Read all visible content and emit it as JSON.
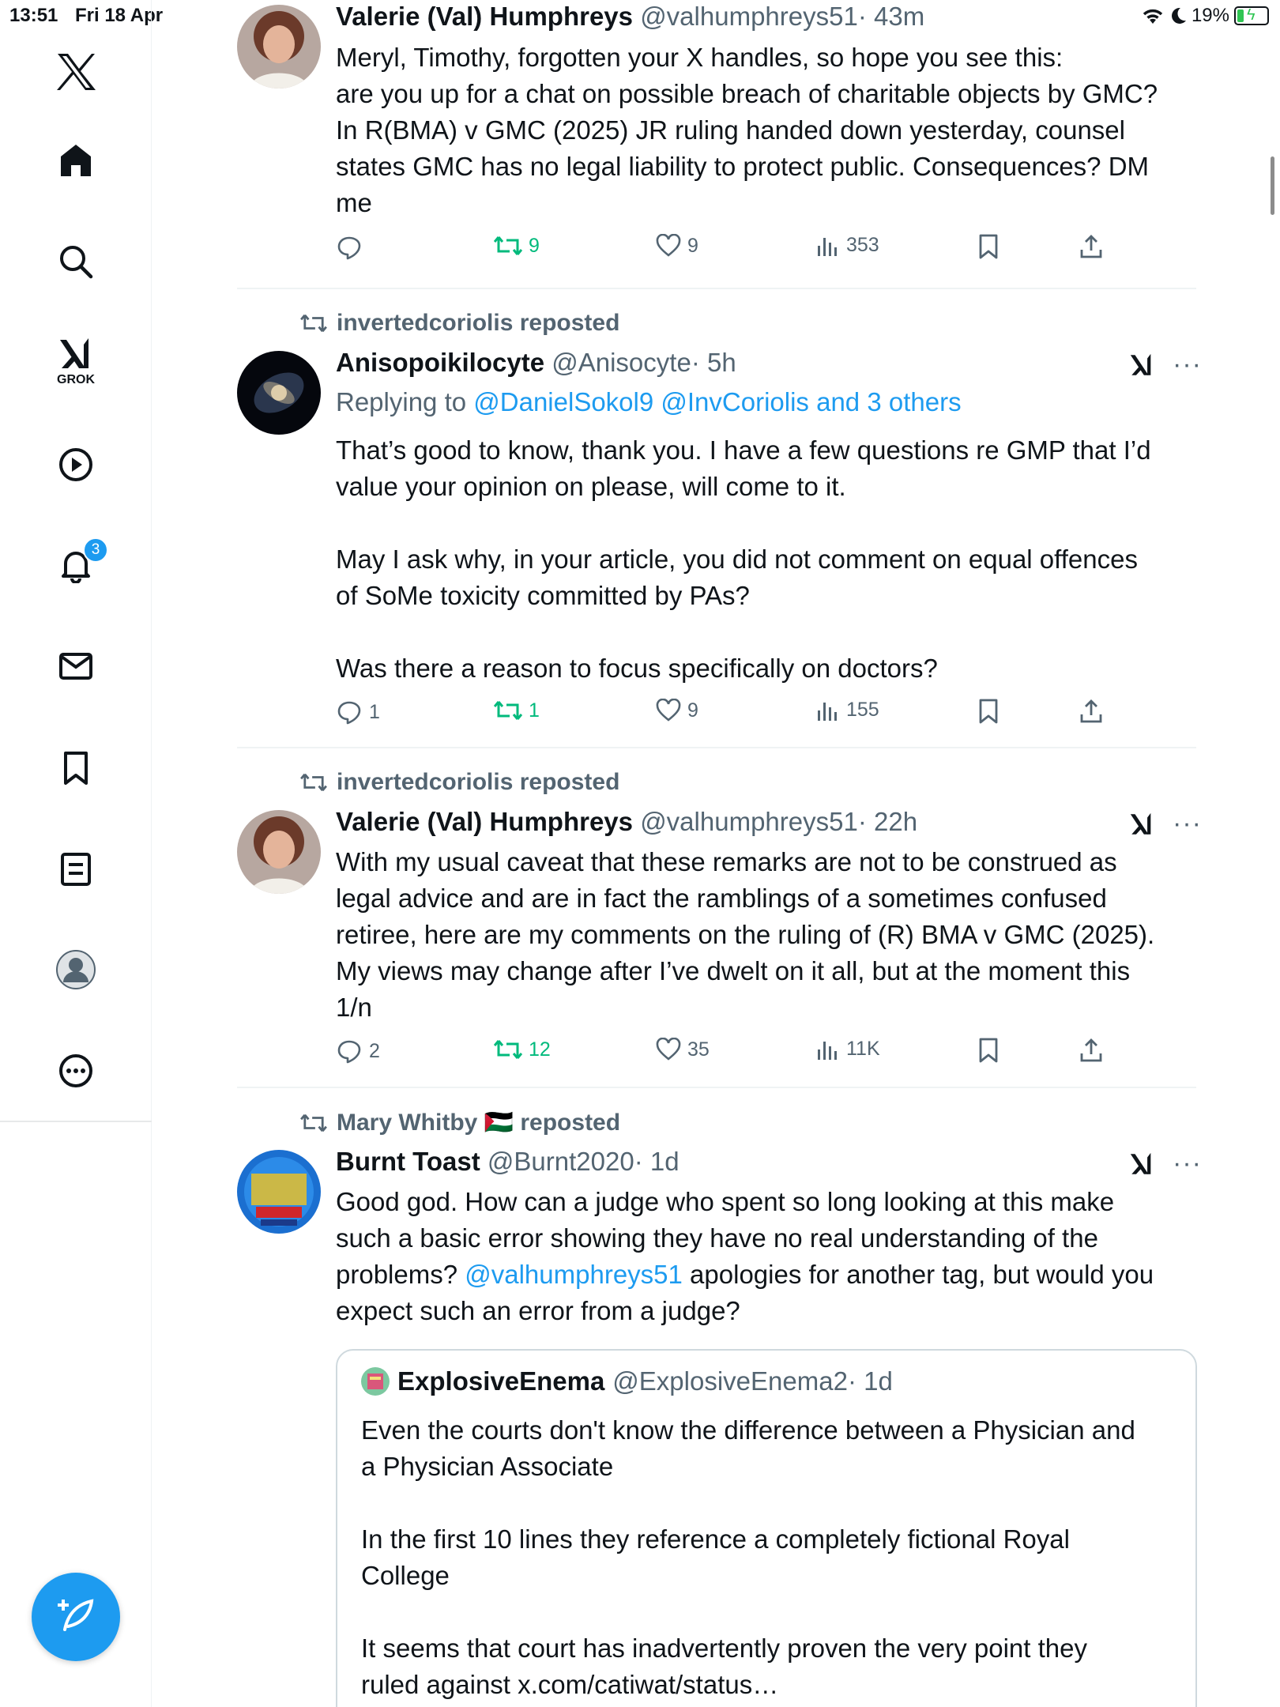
{
  "status_bar": {
    "time": "13:51",
    "date": "Fri 18 Apr",
    "battery": "19%"
  },
  "sidebar": {
    "items": [
      {
        "name": "x-logo-icon"
      },
      {
        "name": "home-icon"
      },
      {
        "name": "search-icon"
      },
      {
        "name": "grok-icon",
        "label": "GROK"
      },
      {
        "name": "play-icon"
      },
      {
        "name": "notifications-icon",
        "badge": "3"
      },
      {
        "name": "mail-icon"
      },
      {
        "name": "bookmark-icon"
      },
      {
        "name": "lists-icon"
      },
      {
        "name": "profile-icon"
      },
      {
        "name": "more-icon"
      }
    ]
  },
  "posts": [
    {
      "name": "Valerie (Val) Humphreys",
      "handle": "@valhumphreys51",
      "time": "· 43m",
      "text": "Meryl, Timothy, forgotten your X handles, so hope you see this:\nare you up for a chat on possible breach of charitable objects by GMC?\nIn R(BMA) v GMC (2025) JR ruling handed down yesterday, counsel\nstates GMC has no legal liability to protect public. Consequences? DM\nme",
      "replies": "",
      "reposts": "9",
      "likes": "9",
      "views": "353"
    },
    {
      "repost_by": "invertedcoriolis reposted",
      "name": "Anisopoikilocyte",
      "handle": "@Anisocyte",
      "time": "· 5h",
      "replying_prefix": "Replying to ",
      "replying_to": "@DanielSokol9 @InvCoriolis and 3 others",
      "text": "That’s good to know, thank you. I have a few questions re GMP that I’d\nvalue your opinion on please, will come to it.\n\nMay I ask why, in your article, you did not comment on equal offences\nof SoMe toxicity committed by PAs?\n\nWas there a reason to focus specifically on doctors?",
      "replies": "1",
      "reposts": "1",
      "likes": "9",
      "views": "155"
    },
    {
      "repost_by": "invertedcoriolis reposted",
      "name": "Valerie (Val) Humphreys",
      "handle": "@valhumphreys51",
      "time": "· 22h",
      "text": "With my usual caveat that these remarks are not to be construed as\nlegal advice and are in fact the ramblings of a sometimes confused\nretiree, here are my comments on the ruling of (R) BMA v GMC (2025).\nMy views may change after I’ve dwelt on it all, but at the moment this\n1/n",
      "replies": "2",
      "reposts": "12",
      "likes": "35",
      "views": "11K"
    },
    {
      "repost_by": "Mary Whitby 🇵🇸 reposted",
      "name": "Burnt Toast",
      "handle": "@Burnt2020",
      "time": "· 1d",
      "text_before_mention": "Good god. How can a judge who spent so long looking at this make\nsuch a basic error showing they have no real understanding of the\nproblems? ",
      "mention": "@valhumphreys51",
      "text_after_mention": " apologies for another tag, but would you\nexpect such an error from a judge?",
      "quote": {
        "name": "ExplosiveEnema",
        "handle": "@ExplosiveEnema2",
        "time": "· 1d",
        "text": "Even the courts don't know the difference between a Physician and\na Physician Associate\n\nIn the first 10 lines they reference a completely fictional Royal\nCollege\n\nIt seems that court has inadvertently proven the very point they\nruled against x.com/catiwat/status…"
      }
    }
  ],
  "colors": {
    "accent": "#1d9bf0",
    "repost_green": "#00ba7c",
    "muted": "#536471",
    "text": "#0f1419"
  }
}
